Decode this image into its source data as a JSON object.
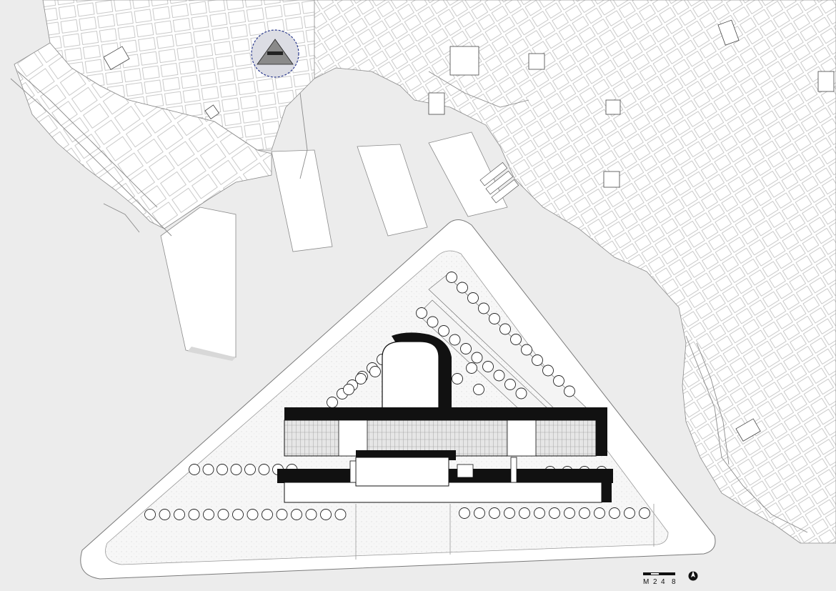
{
  "map": {
    "colors": {
      "paper": "#ffffff",
      "water": "#e9e9e9",
      "land_fill": "#fafafa",
      "street_line": "#9a9a9a",
      "building_black": "#111111",
      "marker_ring": "#2b3a8c",
      "marker_fill": "#d7d9e2"
    },
    "scale_bar": {
      "label_m": "M",
      "label_2": "2",
      "label_4": "4",
      "label_8": "8"
    },
    "north_arrow_icon": "north-arrow-icon",
    "location_marker_icon": "dashed-circle-locator-icon"
  }
}
